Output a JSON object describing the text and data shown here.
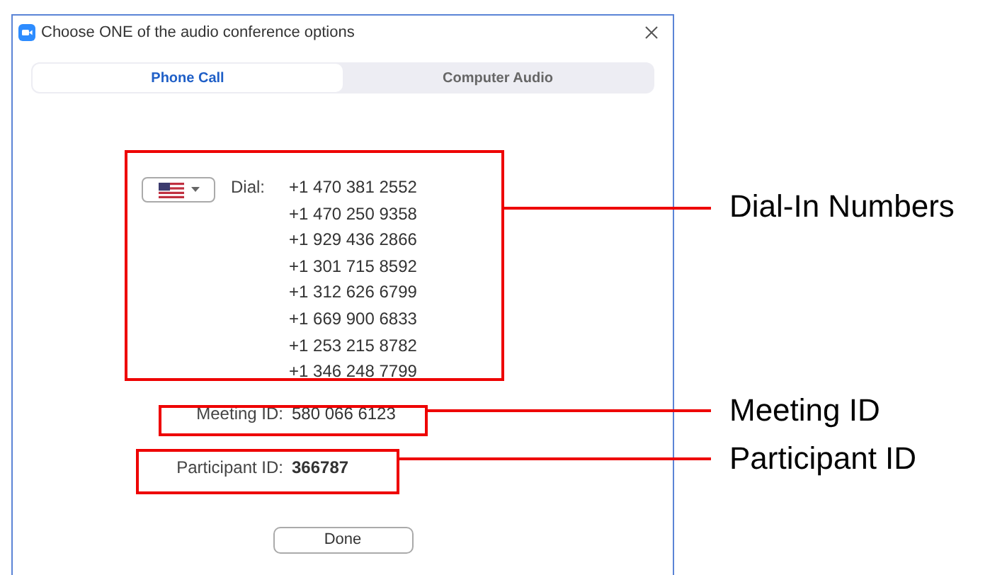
{
  "window": {
    "title": "Choose ONE of the audio conference options"
  },
  "tabs": [
    {
      "label": "Phone Call",
      "selected": true
    },
    {
      "label": "Computer Audio",
      "selected": false
    }
  ],
  "dial": {
    "label": "Dial:",
    "numbers": [
      "+1 470 381 2552",
      "+1 470 250 9358",
      "+1 929 436 2866",
      "+1 301 715 8592",
      "+1 312 626 6799",
      "+1 669 900 6833",
      "+1 253 215 8782",
      "+1 346 248 7799"
    ]
  },
  "meeting_id": {
    "label": "Meeting ID:",
    "value": "580 066 6123"
  },
  "participant_id": {
    "label": "Participant ID:",
    "value": "366787"
  },
  "done_button": "Done",
  "annotations": [
    {
      "label": "Dial-In Numbers"
    },
    {
      "label": "Meeting ID"
    },
    {
      "label": "Participant ID"
    }
  ]
}
